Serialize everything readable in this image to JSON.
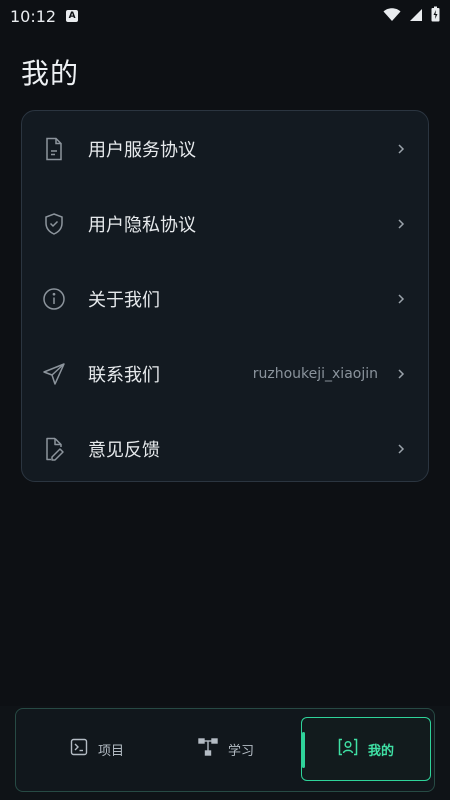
{
  "status_bar": {
    "time": "10:12",
    "notification_letter": "A"
  },
  "page_title": "我的",
  "menu": [
    {
      "label": "用户服务协议",
      "value": "",
      "icon": "document-icon"
    },
    {
      "label": "用户隐私协议",
      "value": "",
      "icon": "shield-check-icon"
    },
    {
      "label": "关于我们",
      "value": "",
      "icon": "info-icon"
    },
    {
      "label": "联系我们",
      "value": "ruzhoukeji_xiaojin",
      "icon": "send-icon"
    },
    {
      "label": "意见反馈",
      "value": "",
      "icon": "feedback-edit-icon"
    }
  ],
  "bottom_nav": [
    {
      "label": "项目",
      "icon": "terminal-icon",
      "active": false
    },
    {
      "label": "学习",
      "icon": "flow-icon",
      "active": false
    },
    {
      "label": "我的",
      "icon": "user-frame-icon",
      "active": true
    }
  ],
  "colors": {
    "accent": "#2fd39a",
    "background": "#0d1014",
    "card": "#131a21"
  }
}
